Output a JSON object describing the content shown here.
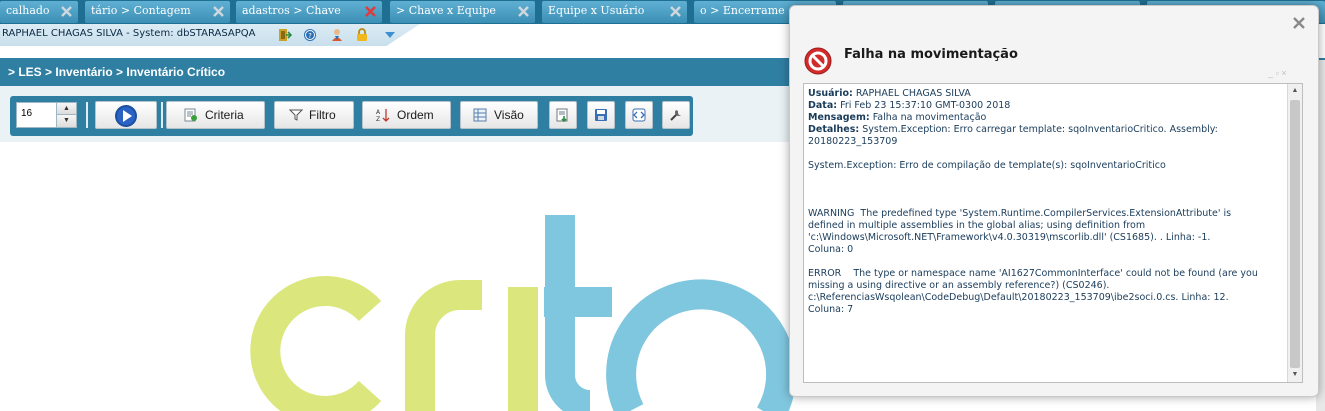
{
  "tabs": [
    {
      "label": "calhado"
    },
    {
      "label": "tário > Contagem"
    },
    {
      "label": "adastros > Chave"
    },
    {
      "label": "> Chave x Equipe"
    },
    {
      "label": "Equipe x Usuário"
    },
    {
      "label": "o > Encerrame"
    },
    {
      "label": ""
    },
    {
      "label": ""
    },
    {
      "label": ""
    }
  ],
  "header": {
    "user_info": "RAPHAEL CHAGAS SILVA - System: dbSTARASAPQA",
    "icons": [
      "exit-icon",
      "help-icon",
      "user-icon",
      "lock-icon",
      "chevron-down-icon"
    ]
  },
  "breadcrumb": "> LES > Inventário > Inventário Crítico",
  "toolbar": {
    "page_size": "16",
    "run_icon": "play-icon",
    "criteria_label": "Criteria",
    "filtro_label": "Filtro",
    "ordem_label": "Ordem",
    "visao_label": "Visão",
    "extra_icons": [
      "export-icon",
      "save-icon",
      "code-icon",
      "settings-icon"
    ]
  },
  "logo": {
    "colors": {
      "lime": "#dbe77c",
      "blue": "#7fc6df"
    }
  },
  "colors": {
    "tab_bar": "#1f6f93",
    "panel_blue": "#2f7fa3",
    "error_red": "#d22b2b"
  },
  "modal": {
    "title": "Falha na movimentação",
    "icon": "error-icon",
    "usuario_label": "Usuário:",
    "usuario_value": "RAPHAEL CHAGAS SILVA",
    "data_label": "Data:",
    "data_value": "Fri Feb 23 15:37:10 GMT-0300 2018",
    "mensagem_label": "Mensagem:",
    "mensagem_value": "Falha na movimentação",
    "detalhes_label": "Detalhes:",
    "detalhes_value": "System.Exception: Erro carregar template: sqoInventarioCritico. Assembly:",
    "line_assembly": "20180223_153709",
    "line_exception": "System.Exception: Erro de compilação de template(s): sqoInventarioCritico",
    "warning_lines": [
      "WARNING  The predefined type 'System.Runtime.CompilerServices.ExtensionAttribute' is",
      "defined in multiple assemblies in the global alias; using definition from",
      "'c:\\Windows\\Microsoft.NET\\Framework\\v4.0.30319\\mscorlib.dll' (CS1685). . Linha: -1.",
      "Coluna: 0"
    ],
    "error_lines": [
      "ERROR    The type or namespace name 'AI1627CommonInterface' could not be found (are you",
      "missing a using directive or an assembly reference?) (CS0246).",
      "c:\\ReferenciasWsqolean\\CodeDebug\\Default\\20180223_153709\\ibe2soci.0.cs. Linha: 12.",
      "Coluna: 7"
    ]
  }
}
